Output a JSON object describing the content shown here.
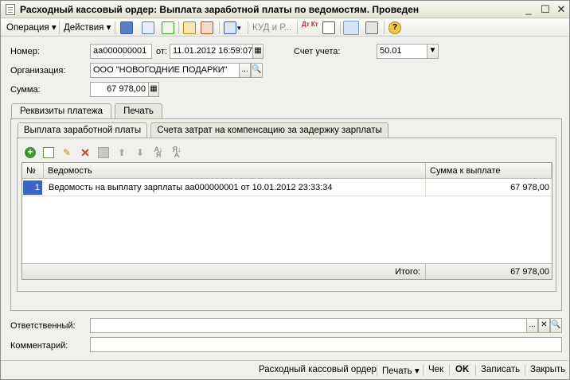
{
  "window": {
    "title": "Расходный кассовый ордер: Выплата заработной платы по ведомостям. Проведен",
    "controls": {
      "minimize": "_",
      "maximize": "☐",
      "close": "✕"
    }
  },
  "toolbar": {
    "operation_label": "Операция",
    "actions_label": "Действия",
    "kud_label": "КУД и Р...",
    "dtkt_label": "Дт Кт",
    "help_label": "?"
  },
  "form": {
    "number_label": "Номер:",
    "number_value": "аа000000001",
    "from_label": "от:",
    "date_value": "11.01.2012 16:59:07",
    "account_label": "Счет учета:",
    "account_value": "50.01",
    "org_label": "Организация:",
    "org_value": "ООО \"НОВОГОДНИЕ ПОДАРКИ\"",
    "sum_label": "Сумма:",
    "sum_value": "67 978,00",
    "select_button": "...",
    "clear_button": "✕"
  },
  "tabs": {
    "outer": [
      "Реквизиты платежа",
      "Печать"
    ],
    "inner": [
      "Выплата заработной платы",
      "Счета затрат на компенсацию за задержку зарплаты"
    ]
  },
  "grid": {
    "headers": {
      "num": "№",
      "statement": "Ведомость",
      "amount": "Сумма к выплате"
    },
    "rows": [
      {
        "num": "1",
        "statement": "Ведомость на выплату зарплаты аа000000001 от 10.01.2012 23:33:34",
        "amount": "67 978,00"
      }
    ],
    "footer": {
      "label": "Итого:",
      "total": "67 978,00"
    }
  },
  "bottom": {
    "responsible_label": "Ответственный:",
    "responsible_value": "",
    "comment_label": "Комментарий:",
    "comment_value": ""
  },
  "statusbar": {
    "doc_name": "Расходный кассовый ордер",
    "print": "Печать",
    "check": "Чек",
    "ok": "OK",
    "save": "Записать",
    "close": "Закрыть"
  },
  "colors": {
    "accent_blue": "#2f5fc4",
    "add_green": "#3c9a2c",
    "delete_red": "#d8362c",
    "selection": "#3a64c8"
  }
}
